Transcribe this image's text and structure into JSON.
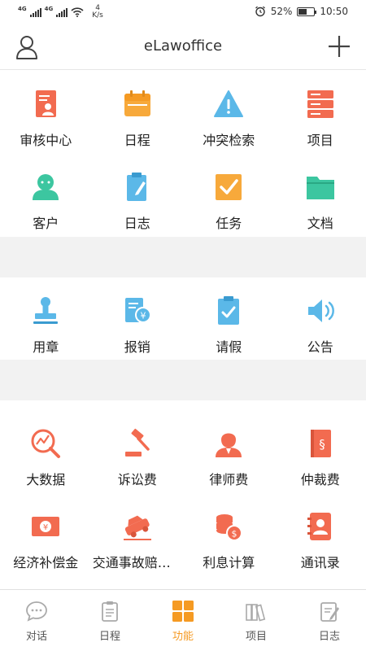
{
  "status_bar": {
    "network_left": "4G",
    "network_right": "4G",
    "speed_value": "4",
    "speed_unit": "K/s",
    "battery": "52%",
    "battery_level": 0.52,
    "time": "10:50"
  },
  "header": {
    "title": "eLawoffice",
    "user_icon": "user-icon",
    "add_icon": "plus-icon"
  },
  "grid1": [
    {
      "label": "审核中心",
      "icon": "review-doc-icon",
      "color": "#f26b50"
    },
    {
      "label": "日程",
      "icon": "calendar-icon",
      "color": "#f7a93b"
    },
    {
      "label": "冲突检索",
      "icon": "warning-icon",
      "color": "#5bb8e8"
    },
    {
      "label": "项目",
      "icon": "server-stack-icon",
      "color": "#f26b50"
    },
    {
      "label": "客户",
      "icon": "customer-icon",
      "color": "#3cc6a0"
    },
    {
      "label": "日志",
      "icon": "clipboard-pen-icon",
      "color": "#5bb8e8"
    },
    {
      "label": "任务",
      "icon": "task-check-icon",
      "color": "#f7a93b"
    },
    {
      "label": "文档",
      "icon": "folder-icon",
      "color": "#3cc6a0"
    }
  ],
  "grid2": [
    {
      "label": "用章",
      "icon": "stamp-icon",
      "color": "#5bb8e8"
    },
    {
      "label": "报销",
      "icon": "reimburse-icon",
      "color": "#5bb8e8"
    },
    {
      "label": "请假",
      "icon": "leave-clipboard-icon",
      "color": "#5bb8e8"
    },
    {
      "label": "公告",
      "icon": "speaker-icon",
      "color": "#5bb8e8"
    }
  ],
  "grid3": [
    {
      "label": "大数据",
      "icon": "chart-magnifier-icon",
      "color": "#f26b50"
    },
    {
      "label": "诉讼费",
      "icon": "gavel-icon",
      "color": "#f26b50"
    },
    {
      "label": "律师费",
      "icon": "lawyer-icon",
      "color": "#f26b50"
    },
    {
      "label": "仲裁费",
      "icon": "law-book-icon",
      "color": "#f26b50"
    },
    {
      "label": "经济补偿金",
      "icon": "money-icon",
      "color": "#f26b50"
    },
    {
      "label": "交通事故赔偿金",
      "icon": "car-crash-icon",
      "color": "#f26b50"
    },
    {
      "label": "利息计算",
      "icon": "coins-icon",
      "color": "#f26b50"
    },
    {
      "label": "通讯录",
      "icon": "contacts-icon",
      "color": "#f26b50"
    }
  ],
  "tabs": [
    {
      "label": "对话",
      "icon": "chat-icon",
      "active": false
    },
    {
      "label": "日程",
      "icon": "schedule-icon",
      "active": false
    },
    {
      "label": "功能",
      "icon": "grid-icon",
      "active": true
    },
    {
      "label": "项目",
      "icon": "binders-icon",
      "active": false
    },
    {
      "label": "日志",
      "icon": "log-icon",
      "active": false
    }
  ],
  "colors": {
    "accent": "#f59a23",
    "red": "#f26b50",
    "orange": "#f7a93b",
    "blue": "#5bb8e8",
    "green": "#3cc6a0",
    "tab_inactive": "#aaaaaa"
  }
}
